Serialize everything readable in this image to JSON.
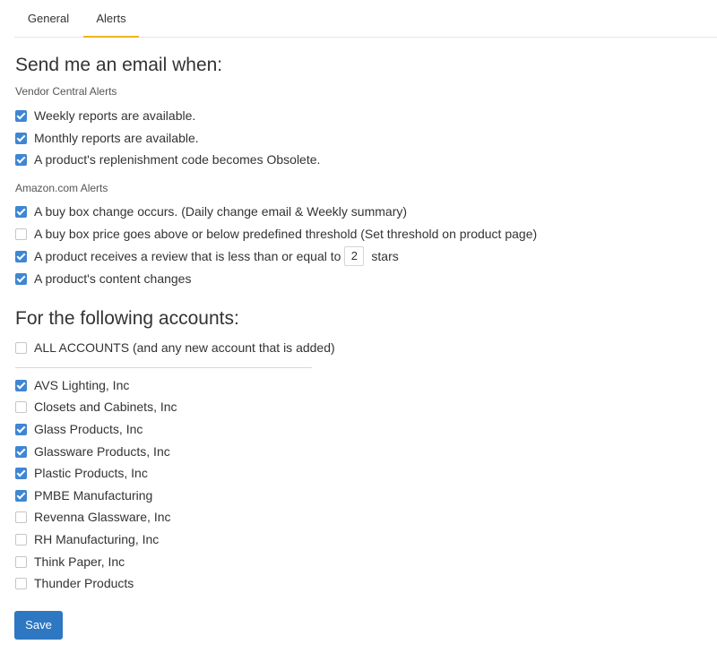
{
  "tabs": [
    {
      "label": "General",
      "active": false
    },
    {
      "label": "Alerts",
      "active": true
    }
  ],
  "colors": {
    "accent_tab": "#f0b323",
    "checkbox_checked": "#3f86d3",
    "save_button": "#2e77c2"
  },
  "email_section": {
    "heading": "Send me an email when:",
    "vendor_central": {
      "label": "Vendor Central Alerts",
      "items": [
        {
          "label": "Weekly reports are available.",
          "checked": true
        },
        {
          "label": "Monthly reports are available.",
          "checked": true
        },
        {
          "label": "A product's replenishment code becomes Obsolete.",
          "checked": true
        }
      ]
    },
    "amazon": {
      "label": "Amazon.com Alerts",
      "items": [
        {
          "label": "A buy box change occurs. (Daily change email & Weekly summary)",
          "checked": true
        },
        {
          "label": "A buy box price goes above or below predefined threshold (Set threshold on product page)",
          "checked": false
        },
        {
          "label_before": "A product receives a review that is less than or equal to",
          "stars_value": "2",
          "label_after": "stars",
          "checked": true
        },
        {
          "label": "A product's content changes",
          "checked": true
        }
      ]
    }
  },
  "accounts_section": {
    "heading": "For the following accounts:",
    "all_accounts": {
      "label": "ALL ACCOUNTS (and any new account that is added)",
      "checked": false
    },
    "accounts": [
      {
        "label": "AVS Lighting, Inc",
        "checked": true
      },
      {
        "label": "Closets and Cabinets, Inc",
        "checked": false
      },
      {
        "label": "Glass Products, Inc",
        "checked": true
      },
      {
        "label": "Glassware Products, Inc",
        "checked": true
      },
      {
        "label": "Plastic Products, Inc",
        "checked": true
      },
      {
        "label": "PMBE Manufacturing",
        "checked": true
      },
      {
        "label": "Revenna Glassware, Inc",
        "checked": false
      },
      {
        "label": "RH Manufacturing, Inc",
        "checked": false
      },
      {
        "label": "Think Paper, Inc",
        "checked": false
      },
      {
        "label": "Thunder Products",
        "checked": false
      }
    ]
  },
  "save_label": "Save"
}
